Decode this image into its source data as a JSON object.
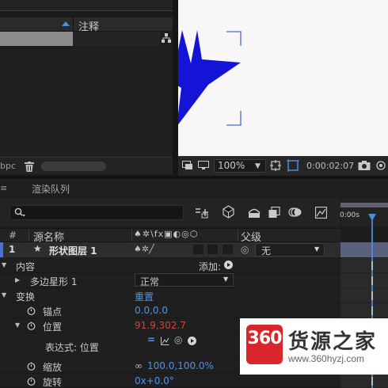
{
  "project_panel": {
    "notes_column": "注释",
    "bpc_label": "bpc",
    "icons": [
      "sort-ascending-icon",
      "flowchart-icon",
      "trash-icon"
    ]
  },
  "composition_viewer": {
    "shape_color": "#1414d6",
    "background_color": "#f8f6f6",
    "zoom": "100%",
    "timecode": "0:00:02:07",
    "icons": [
      "snapshot-toggle-icon",
      "monitor-icon",
      "fit-icon",
      "region-of-interest-icon",
      "camera-icon"
    ]
  },
  "timeline": {
    "tabs": {
      "close": "≡",
      "render_queue": "渲染队列"
    },
    "ruler_start": "0:00s",
    "columns": {
      "hash": "#",
      "source_name": "源名称",
      "switches": "♠✲\\fx▣◐◎⬡",
      "parent": "父级"
    },
    "layer": {
      "number": "1",
      "name": "形状图层 1",
      "parent_value": "无",
      "label_color": "#4b71d6"
    },
    "properties": {
      "contents": "内容",
      "add_label": "添加:",
      "polystar": "多边星形 1",
      "blend_mode": "正常",
      "transform": "变换",
      "reset": "重置",
      "anchor": "锚点",
      "anchor_value": "0.0,0.0",
      "position": "位置",
      "position_value": "91.9,302.7",
      "expression": "表达式: 位置",
      "scale": "缩放",
      "scale_value": "100.0,100.0%",
      "rotation": "旋转",
      "rotation_value": "0x+0.0°"
    }
  },
  "watermark": {
    "logo_text": "360",
    "name": "货源之家",
    "url": "www.360hyzj.com"
  }
}
